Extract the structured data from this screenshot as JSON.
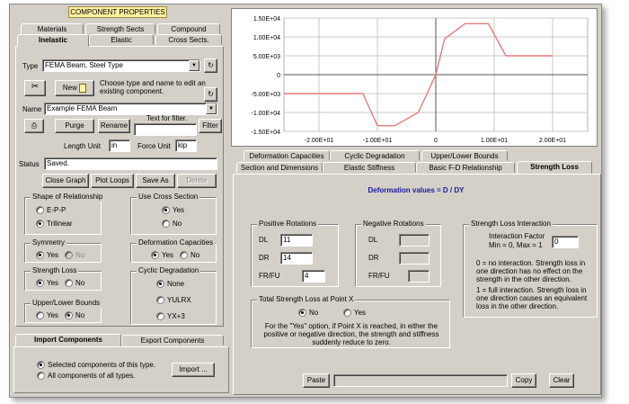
{
  "header": {
    "title": "COMPONENT PROPERTIES"
  },
  "top_tabs": [
    "Materials",
    "Strength Sects",
    "Compound"
  ],
  "sub_tabs": [
    "Inelastic",
    "Elastic",
    "Cross Sects."
  ],
  "type_row": {
    "label": "Type",
    "value": "FEMA Beam, Steel Type"
  },
  "new_row": {
    "new_label": "New",
    "hint": "Choose type and name to edit an existing component."
  },
  "name_row": {
    "label": "Name",
    "value": "Example FEMA Beam"
  },
  "action_row": {
    "purge": "Purge",
    "rename": "Rename",
    "filter_hint": "Text for filter.",
    "filter": "Filter"
  },
  "units": {
    "length_label": "Length Unit",
    "length_value": "in",
    "force_label": "Force Unit",
    "force_value": "kip"
  },
  "status": {
    "label": "Status",
    "value": "Saved."
  },
  "buttons": {
    "close_graph": "Close Graph",
    "plot_loops": "Plot Loops",
    "save_as": "Save As",
    "delete": "Delete"
  },
  "shape": {
    "title": "Shape of Relationship",
    "opt1": "E-P-P",
    "opt2": "Trilinear"
  },
  "use_cross": {
    "title": "Use Cross Section",
    "yes": "Yes",
    "no": "No"
  },
  "symmetry": {
    "title": "Symmetry",
    "yes": "Yes",
    "no": "No"
  },
  "deformation_caps": {
    "title": "Deformation Capacities",
    "yes": "Yes",
    "no": "No"
  },
  "strength_loss": {
    "title": "Strength Loss",
    "yes": "Yes",
    "no": "No"
  },
  "cyclic": {
    "title": "Cyclic Degradation",
    "opt1": "None",
    "opt2": "YULRX",
    "opt3": "YX+3"
  },
  "bounds": {
    "title": "Upper/Lower Bounds",
    "yes": "Yes",
    "no": "No"
  },
  "import_tabs": [
    "Import Components",
    "Export Components"
  ],
  "import": {
    "opt1": "Selected components of this type.",
    "opt2": "All components of all types.",
    "button": "Import ..."
  },
  "chart_data": {
    "type": "line",
    "x": [
      -26,
      -12.5,
      -10,
      -7,
      -3,
      0,
      1.5,
      5,
      9,
      12,
      20
    ],
    "y": [
      -0.5,
      -0.5,
      -1.35,
      -1.35,
      -1.0,
      0,
      0.95,
      1.35,
      1.35,
      0.5,
      0.5
    ],
    "xlim": [
      -26,
      26
    ],
    "ylim": [
      -1.5,
      1.5
    ],
    "xticks": [
      "-2.00E+01",
      "-1.00E+01",
      "0",
      "1.00E+01",
      "2.00E+01"
    ],
    "yticks": [
      "1.50E+04",
      "1.00E+04",
      "5.00E+03",
      "0",
      "-5.00E+03",
      "-1.00E+04",
      "-1.50E+04"
    ],
    "line_color": "#e87a7a",
    "grid": true
  },
  "right_tabs_row1": [
    "Deformation Capacities",
    "Cyclic Degradation",
    "Upper/Lower Bounds"
  ],
  "right_tabs_row2": [
    "Section and Dimensions",
    "Elastic Stiffness",
    "Basic F-D Relationship",
    "Strength Loss"
  ],
  "panel": {
    "heading": "Deformation values = D / DY",
    "pos": {
      "title": "Positive Rotations",
      "dl_label": "DL",
      "dl_value": "11",
      "dr_label": "DR",
      "dr_value": "14",
      "fr_label": "FR/FU",
      "fr_value": "4"
    },
    "neg": {
      "title": "Negative Rotations",
      "dl_label": "DL",
      "dr_label": "DR",
      "fr_label": "FR/FU"
    },
    "interaction": {
      "title": "Strength Loss Interaction",
      "factor_label": "Interaction Factor",
      "range": "Min = 0, Max = 1",
      "value": "0",
      "note1": "0 = no interaction. Strength loss in one direction has no effect on the strength in the other direction.",
      "note2": "1 = full interaction. Strength loss in one direction causes an equivalent loss in the other direction."
    },
    "total": {
      "title": "Total Strength Loss at Point X",
      "no": "No",
      "yes": "Yes",
      "note": "For the \"Yes\" option, if Point X is reached, in either the positive or negative direction, the strength and stiffness suddenly reduce to zero."
    },
    "paste": "Paste",
    "copy": "Copy",
    "clear": "Clear"
  }
}
